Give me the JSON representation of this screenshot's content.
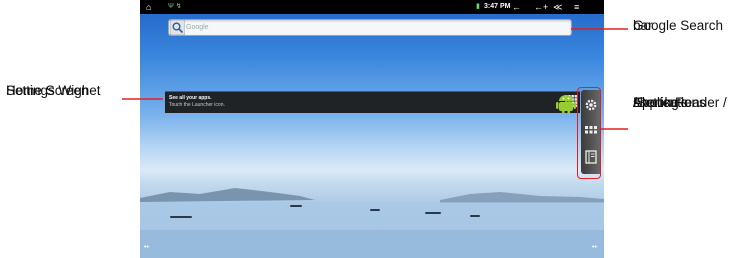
{
  "callouts": {
    "settings_widget": [
      "Home Screen",
      "Settings Wighet"
    ],
    "google_search": [
      "Google Search",
      "bar"
    ],
    "shortcuts": [
      "Ebook Reader /",
      "Applications",
      "/Setting",
      "shortcuts"
    ]
  },
  "status_bar": {
    "time": "3:47 PM"
  },
  "search": {
    "placeholder": "Google"
  },
  "widget": {
    "title": "See all your apps.",
    "subtitle": "Touch the Launcher icon."
  },
  "shortcut_icons": [
    "gear-icon",
    "grid-icon",
    "book-icon"
  ],
  "colors": {
    "callout_line": "#e02020",
    "status_bar": "#000000",
    "sky_top": "#1f63c4"
  }
}
